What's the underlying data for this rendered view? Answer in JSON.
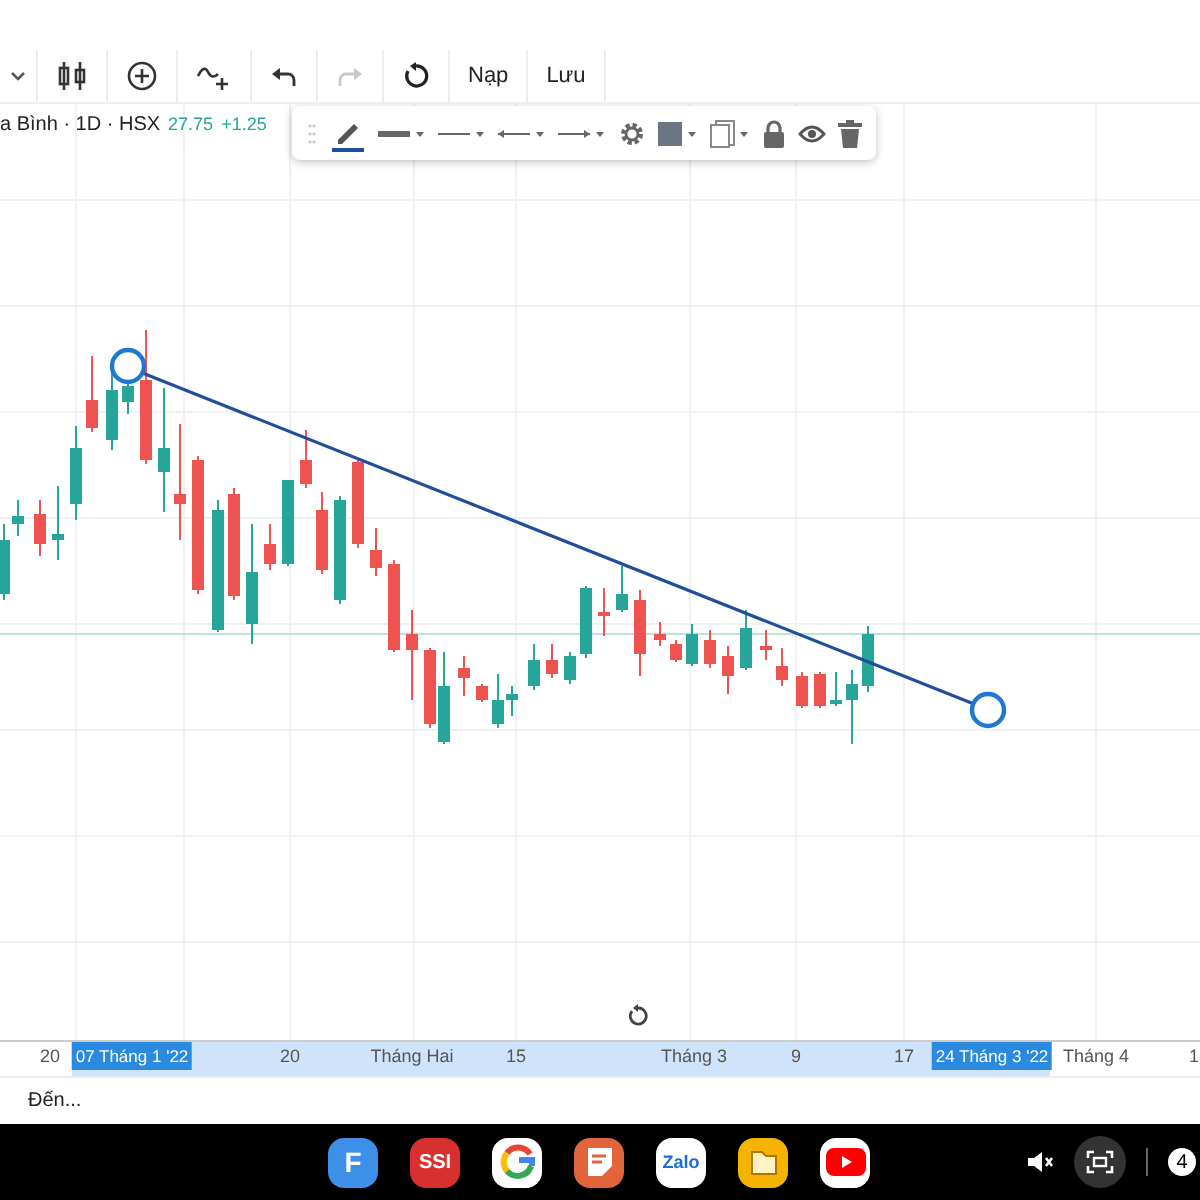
{
  "toolbar": {
    "items": [
      {
        "kind": "caret"
      },
      {
        "kind": "candles"
      },
      {
        "kind": "add"
      },
      {
        "kind": "indicator"
      },
      {
        "kind": "undo",
        "disabled": false
      },
      {
        "kind": "redo",
        "disabled": true
      },
      {
        "kind": "reload"
      },
      {
        "kind": "text",
        "label": "Nạp"
      },
      {
        "kind": "text",
        "label": "Lưu"
      }
    ]
  },
  "symbol": {
    "title": "a Bình · 1D · HSX",
    "price": "27.75",
    "change": "+1.25"
  },
  "drawing_toolbar": {
    "items": [
      {
        "kind": "pencil",
        "color": "#1f4e9c"
      },
      {
        "kind": "thickness"
      },
      {
        "kind": "dotted"
      },
      {
        "kind": "arrow-left"
      },
      {
        "kind": "arrow-right"
      },
      {
        "kind": "gear"
      },
      {
        "kind": "layers"
      },
      {
        "kind": "copy"
      },
      {
        "kind": "lock"
      },
      {
        "kind": "eye"
      },
      {
        "kind": "trash"
      }
    ]
  },
  "time_axis": {
    "labels": [
      {
        "kind": "tick",
        "text": "20"
      },
      {
        "kind": "marker",
        "text": "07 Tháng 1 '22"
      },
      {
        "kind": "tick",
        "text": "20"
      },
      {
        "kind": "tick",
        "text": "Tháng Hai"
      },
      {
        "kind": "tick",
        "text": "15"
      },
      {
        "kind": "tick",
        "text": "Tháng 3"
      },
      {
        "kind": "tick",
        "text": "9"
      },
      {
        "kind": "tick",
        "text": "17"
      },
      {
        "kind": "marker",
        "text": "24 Tháng 3 '22"
      },
      {
        "kind": "tick",
        "text": "Tháng 4"
      },
      {
        "kind": "tick",
        "text": "1"
      }
    ]
  },
  "date_field": {
    "placeholder": "Đến..."
  },
  "taskbar": {
    "apps": [
      {
        "kind": "letter",
        "label": "F",
        "color": "#3d8fe8"
      },
      {
        "kind": "letter",
        "label": "SSI",
        "color": "#d8302f"
      },
      {
        "kind": "g"
      },
      {
        "kind": "notes",
        "color": "#e2643a"
      },
      {
        "kind": "chat",
        "label": "Zalo",
        "color": "#ffffff"
      },
      {
        "kind": "folder",
        "color": "#f4b400"
      },
      {
        "kind": "play",
        "color": "#ffffff"
      }
    ],
    "notification_count": "4"
  }
}
